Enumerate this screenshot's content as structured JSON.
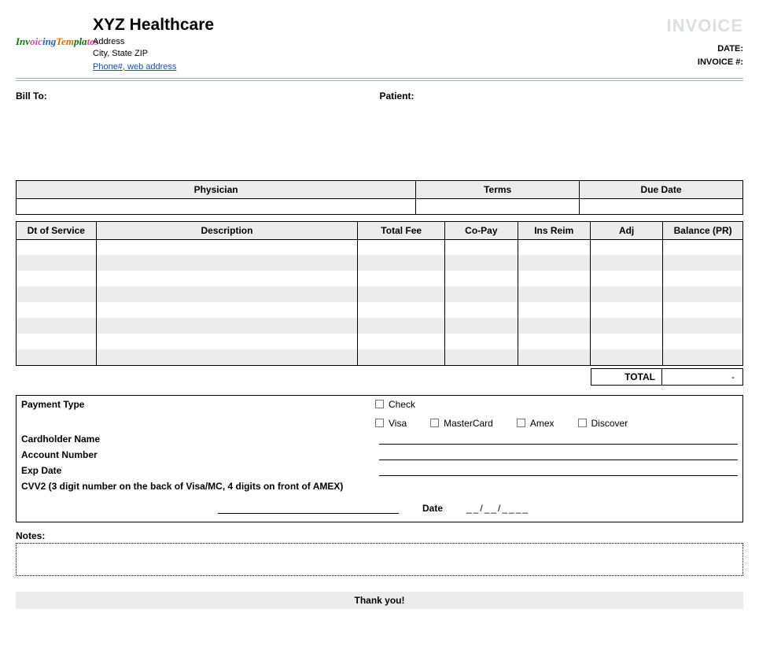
{
  "header": {
    "logo_text": "InvoicingTemplates",
    "company_name": "XYZ Healthcare",
    "address_line1": "Address",
    "address_line2": "City, State ZIP",
    "contact_line": "Phone#, web address",
    "invoice_title": "INVOICE",
    "date_label": "DATE:",
    "invoice_num_label": "INVOICE #:"
  },
  "parties": {
    "billto_label": "Bill To:",
    "patient_label": "Patient:"
  },
  "mini_table": {
    "headers": [
      "Physician",
      "Terms",
      "Due Date"
    ],
    "values": [
      "",
      "",
      ""
    ]
  },
  "items": {
    "headers": [
      "Dt of Service",
      "Description",
      "Total Fee",
      "Co-Pay",
      "Ins Reim",
      "Adj",
      "Balance (PR)"
    ],
    "rows": [
      [
        "",
        "",
        "",
        "",
        "",
        "",
        ""
      ],
      [
        "",
        "",
        "",
        "",
        "",
        "",
        ""
      ],
      [
        "",
        "",
        "",
        "",
        "",
        "",
        ""
      ],
      [
        "",
        "",
        "",
        "",
        "",
        "",
        ""
      ],
      [
        "",
        "",
        "",
        "",
        "",
        "",
        ""
      ],
      [
        "",
        "",
        "",
        "",
        "",
        "",
        ""
      ],
      [
        "",
        "",
        "",
        "",
        "",
        "",
        ""
      ],
      [
        "",
        "",
        "",
        "",
        "",
        "",
        ""
      ]
    ],
    "total_label": "TOTAL",
    "total_value": "-"
  },
  "payment": {
    "type_label": "Payment Type",
    "options": [
      "Check",
      "Visa",
      "MasterCard",
      "Amex",
      "Discover"
    ],
    "cardholder_label": "Cardholder Name",
    "account_label": "Account Number",
    "exp_label": "Exp Date",
    "cvv_label": "CVV2 (3 digit number on the back of Visa/MC, 4 digits on front of AMEX)",
    "date_label": "Date",
    "date_value": "__/__/____"
  },
  "footer": {
    "notes_label": "Notes:",
    "thanks": "Thank you!"
  }
}
